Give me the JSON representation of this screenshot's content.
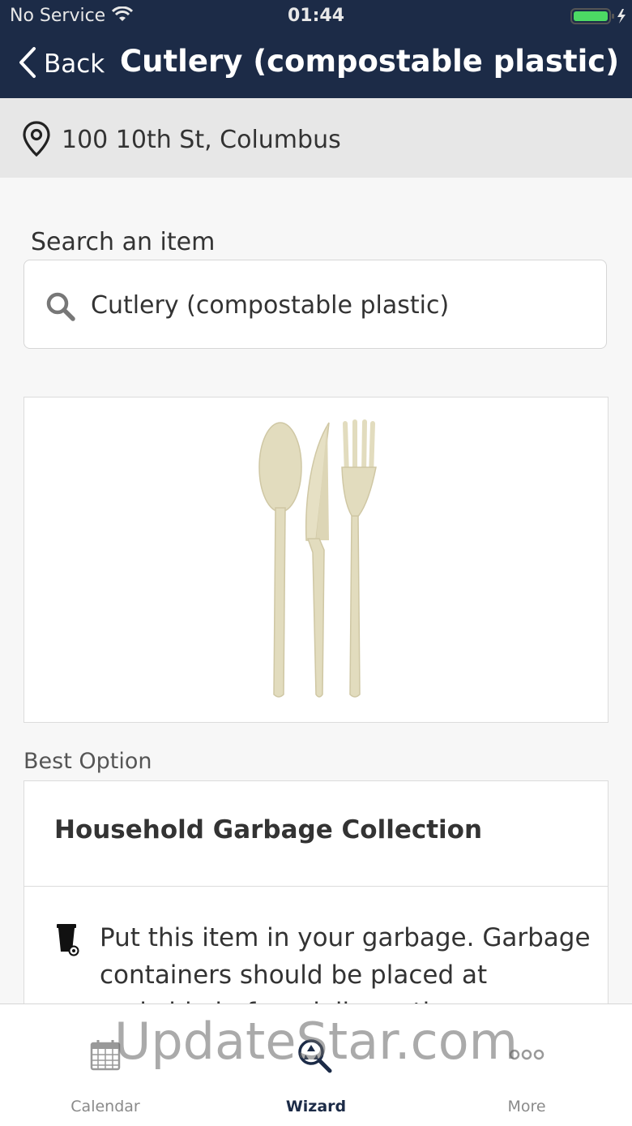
{
  "status_bar": {
    "carrier": "No Service",
    "time": "01:44"
  },
  "nav": {
    "back_label": "Back",
    "title": "Cutlery (compostable plastic)"
  },
  "location": {
    "address": "100 10th St, Columbus"
  },
  "search": {
    "heading": "Search an item",
    "value": "Cutlery (compostable plastic)"
  },
  "best_option": {
    "label": "Best Option",
    "title": "Household Garbage Collection",
    "description": "Put this item in your garbage. Garbage containers should be placed at curbside before delivery time"
  },
  "tabs": [
    {
      "label": "Calendar",
      "icon": "calendar-icon",
      "active": false
    },
    {
      "label": "Wizard",
      "icon": "recycle-search-icon",
      "active": true
    },
    {
      "label": "More",
      "icon": "more-dots-icon",
      "active": false
    }
  ],
  "watermark": "UpdateStar.com",
  "colors": {
    "header": "#1c2b47",
    "location_bar": "#e7e7e7",
    "battery": "#4cd964"
  }
}
